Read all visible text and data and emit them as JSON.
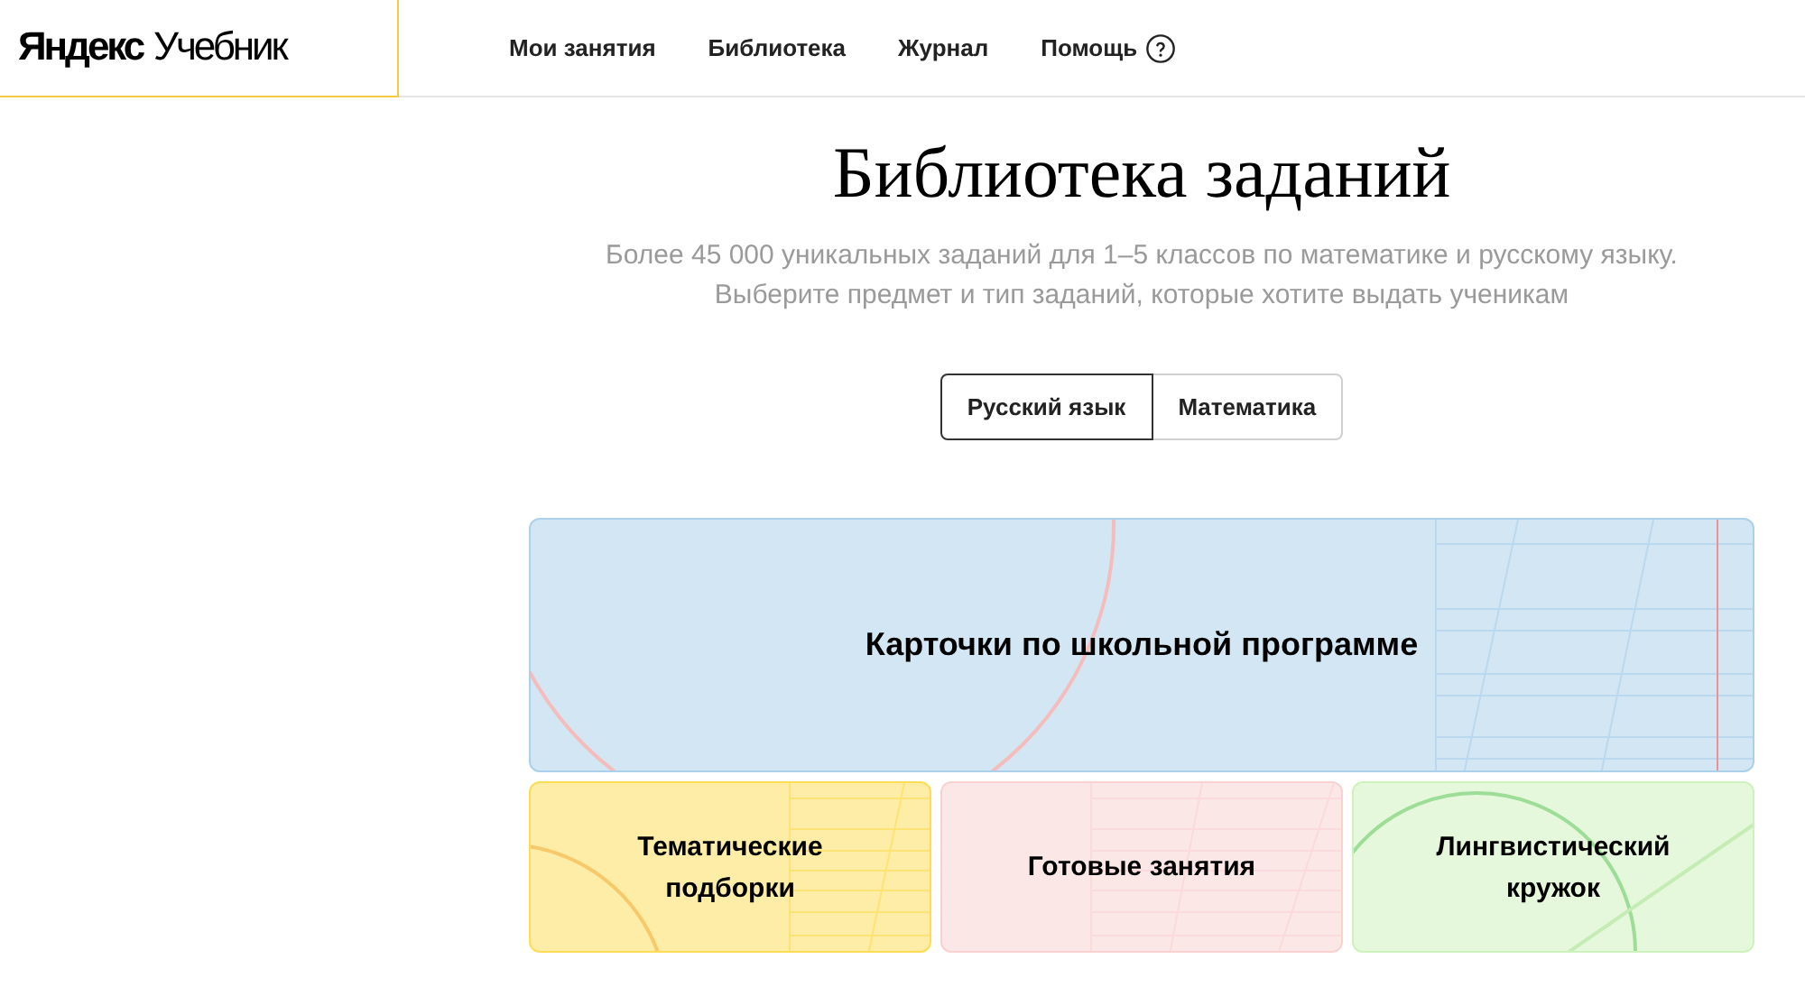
{
  "header": {
    "logo": {
      "brand": "Яндекс",
      "product": "Учебник"
    },
    "nav": [
      {
        "label": "Мои занятия",
        "kind": "link"
      },
      {
        "label": "Библиотека",
        "kind": "link"
      },
      {
        "label": "Журнал",
        "kind": "link"
      },
      {
        "label": "Помощь",
        "kind": "help"
      }
    ]
  },
  "page": {
    "title": "Библиотека заданий",
    "subtitle": [
      "Более 45 000 уникальных заданий для 1–5 классов по математике и русскому языку.",
      "Выберите предмет и тип заданий, которые хотите выдать ученикам"
    ]
  },
  "subject_tabs": [
    {
      "label": "Русский язык",
      "selected": true
    },
    {
      "label": "Математика",
      "selected": false
    }
  ],
  "cards": [
    {
      "title": "Карточки по школьной программе",
      "kind": "wide",
      "color": "#d3e6f4"
    },
    {
      "title": "Тематические подборки",
      "kind": "small",
      "color": "#feeda6"
    },
    {
      "title": "Готовые занятия",
      "kind": "small",
      "color": "#fce7e7"
    },
    {
      "title": "Лингвистический кружок",
      "kind": "small",
      "color": "#e5f8dc"
    }
  ]
}
